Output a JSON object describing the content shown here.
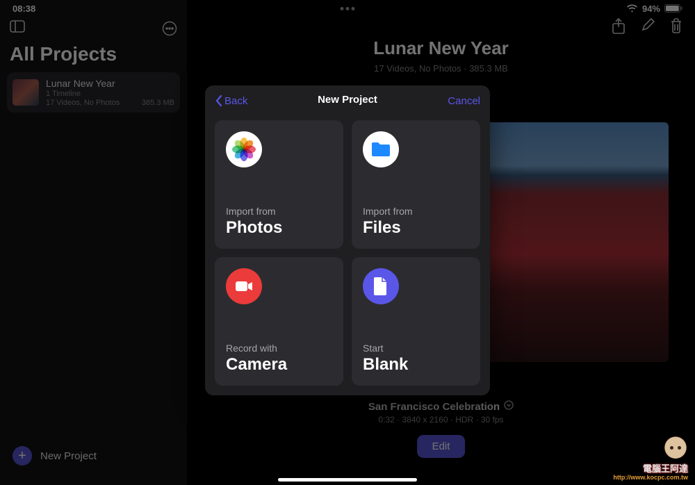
{
  "status": {
    "time": "08:38",
    "battery_pct": "94%"
  },
  "sidebar": {
    "title": "All Projects",
    "project": {
      "name": "Lunar New Year",
      "line1": "1 Timeline",
      "line2": "17 Videos, No Photos",
      "size": "385.3 MB"
    },
    "new_label": "New Project"
  },
  "main": {
    "title": "Lunar New Year",
    "subtitle": "17 Videos, No Photos · 385.3 MB",
    "clip_title": "San Francisco Celebration",
    "clip_sub": "0:32 · 3840 x 2160 · HDR · 30 fps",
    "edit_label": "Edit"
  },
  "modal": {
    "back": "Back",
    "title": "New Project",
    "cancel": "Cancel",
    "cards": {
      "photos": {
        "small": "Import from",
        "big": "Photos"
      },
      "files": {
        "small": "Import from",
        "big": "Files"
      },
      "camera": {
        "small": "Record with",
        "big": "Camera"
      },
      "blank": {
        "small": "Start",
        "big": "Blank"
      }
    }
  },
  "watermark": {
    "line1": "電腦王阿達",
    "line2": "http://www.kocpc.com.tw"
  }
}
